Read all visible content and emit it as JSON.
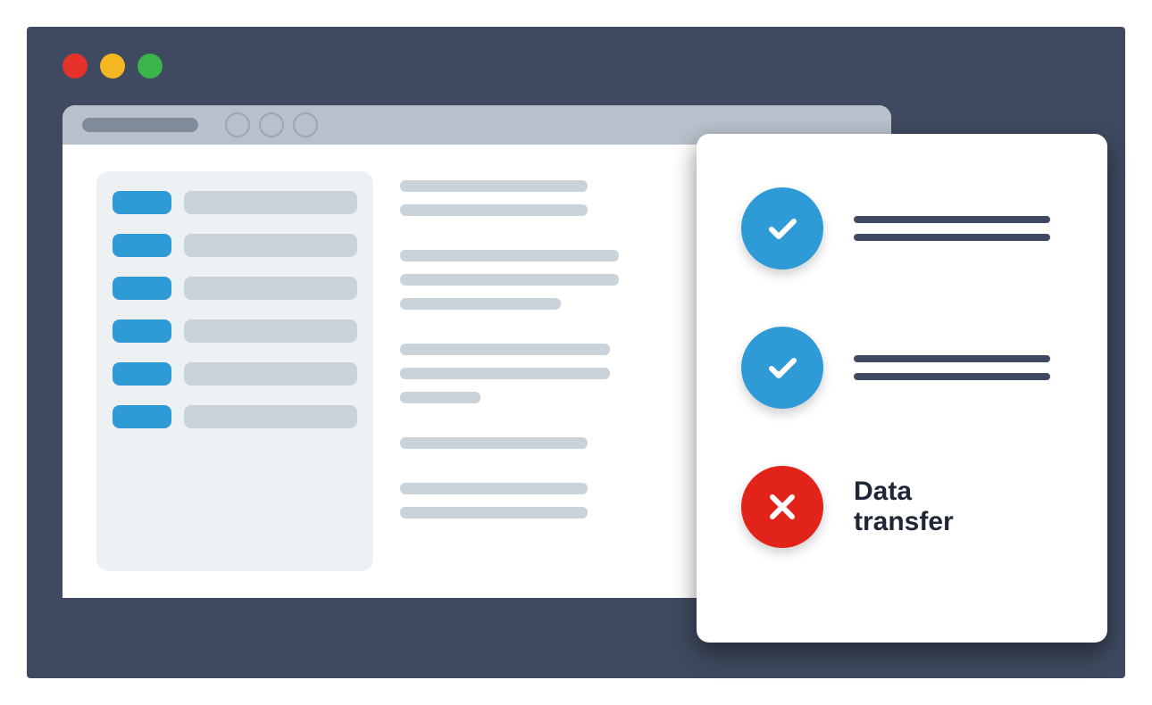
{
  "colors": {
    "stage_bg": "#3f4a60",
    "traffic_red": "#e6312b",
    "traffic_yellow": "#f4b721",
    "traffic_green": "#39b54a",
    "toolbar_bg": "#b8c0cb",
    "url_bar": "#808b9a",
    "nav_circle_border": "#9ba6b3",
    "sidebar_bg": "#eef1f4",
    "pill_blue": "#2e9bd6",
    "pill_gray": "#cbd3da",
    "line_gray": "#cbd3da",
    "status_check_bg": "#2e9bd6",
    "status_fail_bg": "#e2231a",
    "status_line": "#3f4a60",
    "status_text": "#1f2636"
  },
  "browser": {
    "sidebar_items_count": 6,
    "content_paragraphs": [
      {
        "line_widths": [
          210,
          210
        ]
      },
      {
        "line_widths": [
          245,
          245,
          180
        ]
      },
      {
        "line_widths": [
          235,
          235,
          90
        ]
      },
      {
        "line_widths": [
          210
        ]
      },
      {
        "line_widths": [
          210,
          210
        ]
      }
    ]
  },
  "status_card": {
    "items": [
      {
        "state": "ok",
        "lines": [
          220,
          220
        ],
        "label": null
      },
      {
        "state": "ok",
        "lines": [
          220,
          220
        ],
        "label": null
      },
      {
        "state": "fail",
        "lines": [],
        "label": "Data\ntransfer"
      }
    ]
  }
}
